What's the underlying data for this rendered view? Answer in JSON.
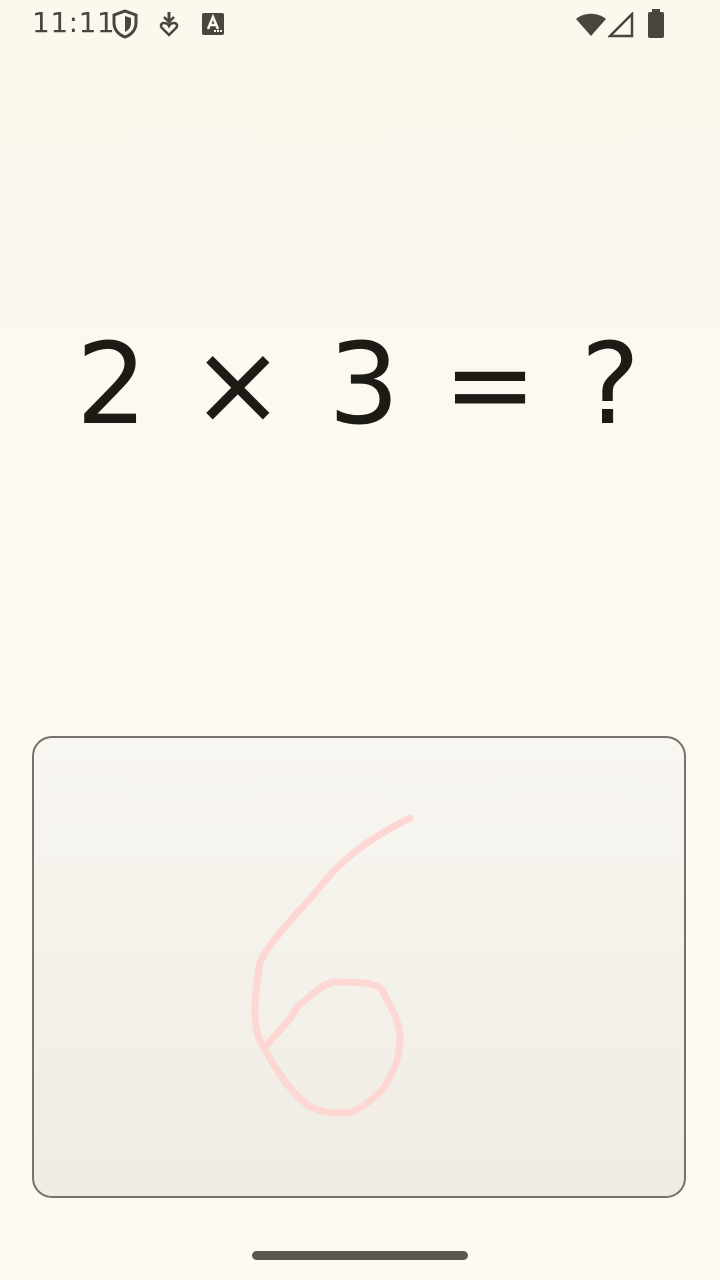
{
  "status_bar": {
    "time": "11:11",
    "icons": [
      "shield-icon",
      "download-icon",
      "font-icon",
      "wifi-icon",
      "cellular-signal-icon",
      "battery-icon"
    ]
  },
  "quiz": {
    "question": "2 × 3 = ?"
  },
  "drawing_pad": {
    "stroke_color": "#fdd7d4",
    "handwritten_value": "6"
  },
  "colors": {
    "background": "#fdf9f0",
    "text": "#1d1b16",
    "pad_border": "#77736a"
  }
}
